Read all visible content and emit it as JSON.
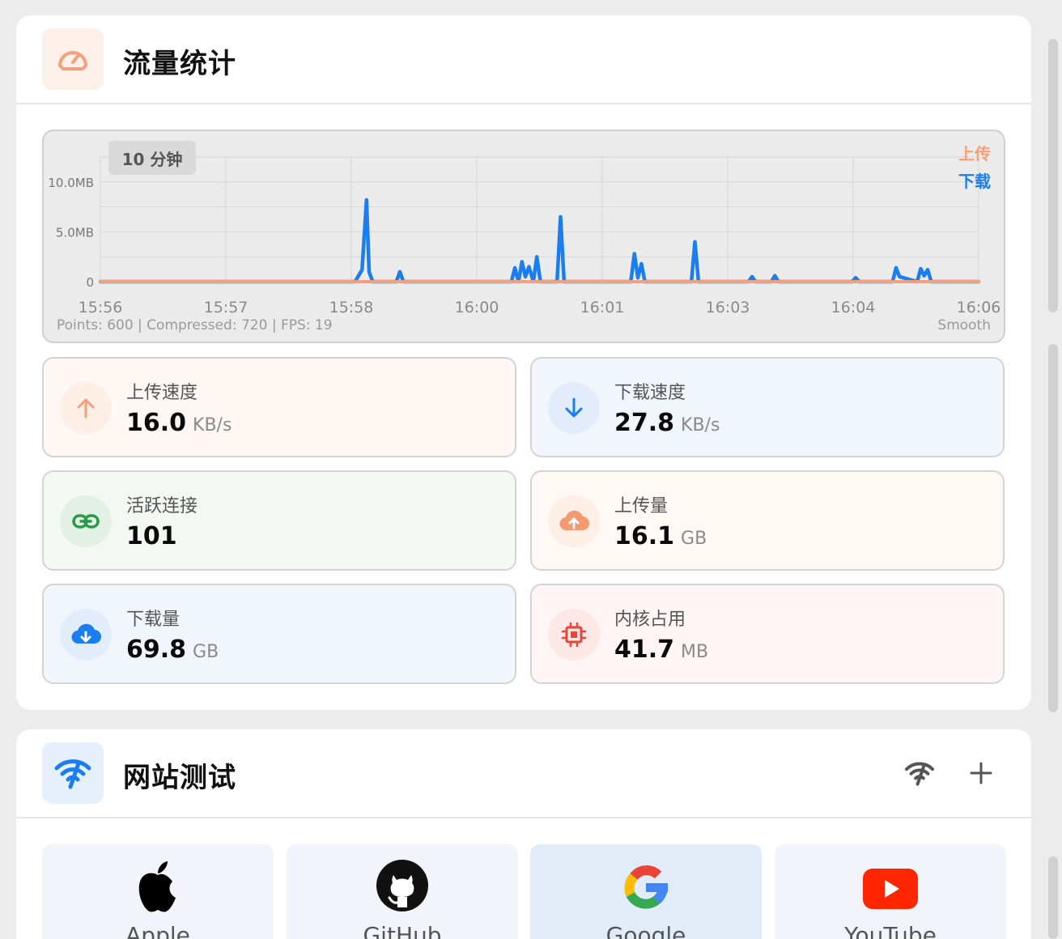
{
  "traffic": {
    "title": "流量统计",
    "icon": "speedometer-icon",
    "accent": "#f4a07c"
  },
  "chart": {
    "range_label": "10 分钟",
    "footer_info": "Points: 600 | Compressed: 720 | FPS: 19",
    "footer_mode": "Smooth"
  },
  "chart_data": {
    "type": "line",
    "title": "",
    "xlabel": "",
    "ylabel": "",
    "y_tick_labels": [
      "10.0MB",
      "5.0MB",
      "0"
    ],
    "y_ticks": [
      10,
      5,
      0
    ],
    "ylim": [
      0,
      12.5
    ],
    "x_tick_labels": [
      "15:56",
      "15:57",
      "15:58",
      "16:00",
      "16:01",
      "16:03",
      "16:04",
      "16:06"
    ],
    "grid": true,
    "legend_position": "top-right",
    "series": [
      {
        "name": "上传",
        "color": "#f4a07c",
        "x": [
          0,
          100
        ],
        "y": [
          0.0,
          0.0
        ]
      },
      {
        "name": "下载",
        "color": "#1a7ef0",
        "x": [
          0,
          29.0,
          29.8,
          30.3,
          30.6,
          31.0,
          33.7,
          34.1,
          34.5,
          46.8,
          47.2,
          47.6,
          48.0,
          48.4,
          48.8,
          49.3,
          49.7,
          50.1,
          52.0,
          52.4,
          52.8,
          60.4,
          60.8,
          61.2,
          61.6,
          62.0,
          67.3,
          67.7,
          68.1,
          73.8,
          74.2,
          74.6,
          76.4,
          76.8,
          77.2,
          85.6,
          86.0,
          86.4,
          90.2,
          90.6,
          91.0,
          93.0,
          93.4,
          93.8,
          94.2,
          94.6,
          100
        ],
        "y": [
          0.0,
          0.0,
          1.2,
          8.2,
          1.0,
          0.0,
          0.0,
          1.0,
          0.0,
          0.0,
          1.4,
          0.0,
          2.0,
          0.5,
          1.5,
          0.0,
          2.5,
          0.0,
          0.0,
          6.5,
          0.0,
          0.0,
          2.8,
          0.4,
          1.8,
          0.0,
          0.0,
          4.0,
          0.0,
          0.0,
          0.5,
          0.0,
          0.0,
          0.6,
          0.0,
          0.0,
          0.4,
          0.0,
          0.0,
          1.4,
          0.5,
          0.0,
          1.3,
          0.6,
          1.2,
          0.0,
          0.0
        ]
      }
    ]
  },
  "stats": [
    {
      "label": "上传速度",
      "value": "16.0",
      "unit": "KB/s",
      "icon": "arrow-up-icon",
      "bg": "#fff7f3",
      "icon_bg": "#fdeee6",
      "icon_color": "#f4a07c"
    },
    {
      "label": "下载速度",
      "value": "27.8",
      "unit": "KB/s",
      "icon": "arrow-down-icon",
      "bg": "#f1f6fd",
      "icon_bg": "#e2ecfb",
      "icon_color": "#1a7ef0"
    },
    {
      "label": "活跃连接",
      "value": "101",
      "unit": "",
      "icon": "link-icon",
      "bg": "#f3f8f3",
      "icon_bg": "#e3f1e5",
      "icon_color": "#2a9a4a"
    },
    {
      "label": "上传量",
      "value": "16.1",
      "unit": "GB",
      "icon": "cloud-upload-icon",
      "bg": "#fff8f5",
      "icon_bg": "#fdeee6",
      "icon_color": "#f49a70"
    },
    {
      "label": "下载量",
      "value": "69.8",
      "unit": "GB",
      "icon": "cloud-download-icon",
      "bg": "#f1f6fd",
      "icon_bg": "#e2ecfb",
      "icon_color": "#1a7ef0"
    },
    {
      "label": "内核占用",
      "value": "41.7",
      "unit": "MB",
      "icon": "chip-icon",
      "bg": "#fff5f4",
      "icon_bg": "#fde8e6",
      "icon_color": "#e5453a"
    }
  ],
  "site_test": {
    "title": "网站测试",
    "icon": "wifi-test-icon",
    "accent": "#1a7ef0",
    "actions": [
      {
        "name": "test-all-button",
        "icon": "wifi-test-icon"
      },
      {
        "name": "add-site-button",
        "icon": "plus-icon"
      }
    ],
    "sites": [
      {
        "name": "Apple",
        "icon": "apple-icon"
      },
      {
        "name": "GitHub",
        "icon": "github-icon"
      },
      {
        "name": "Google",
        "icon": "google-icon",
        "active": true
      },
      {
        "name": "YouTube",
        "icon": "youtube-icon"
      }
    ]
  }
}
